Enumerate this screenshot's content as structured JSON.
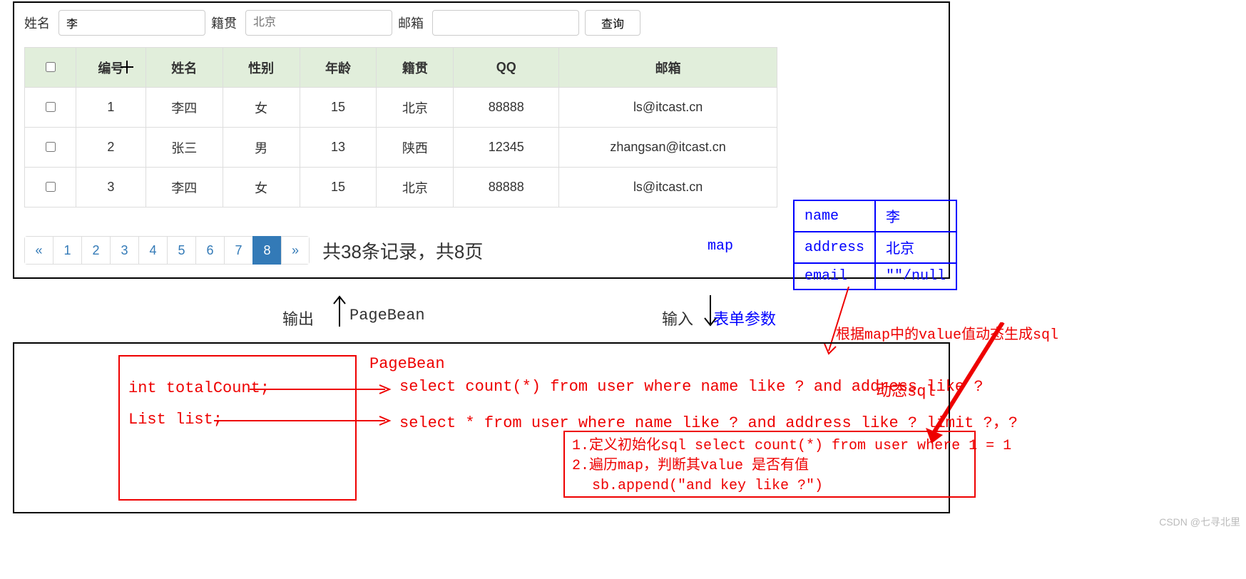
{
  "search": {
    "name_label": "姓名",
    "name_value": "李",
    "native_label": "籍贯",
    "native_placeholder": "北京",
    "email_label": "邮箱",
    "email_value": "",
    "query_btn": "查询"
  },
  "table": {
    "headers": [
      "",
      "编号",
      "姓名",
      "性别",
      "年龄",
      "籍贯",
      "QQ",
      "邮箱"
    ],
    "rows": [
      {
        "id": "1",
        "name": "李四",
        "sex": "女",
        "age": "15",
        "native": "北京",
        "qq": "88888",
        "email": "ls@itcast.cn"
      },
      {
        "id": "2",
        "name": "张三",
        "sex": "男",
        "age": "13",
        "native": "陕西",
        "qq": "12345",
        "email": "zhangsan@itcast.cn"
      },
      {
        "id": "3",
        "name": "李四",
        "sex": "女",
        "age": "15",
        "native": "北京",
        "qq": "88888",
        "email": "ls@itcast.cn"
      }
    ]
  },
  "pager": {
    "prev": "«",
    "pages": [
      "1",
      "2",
      "3",
      "4",
      "5",
      "6",
      "7",
      "8"
    ],
    "active_index": 7,
    "next": "»",
    "info": "共38条记录，共8页"
  },
  "map": {
    "label": "map",
    "rows": [
      {
        "k": "name",
        "v": "李"
      },
      {
        "k": "address",
        "v": "北京"
      },
      {
        "k": "email",
        "v": "\"\"/null"
      }
    ]
  },
  "io": {
    "out_label": "输出",
    "pagebean_label": "PageBean",
    "in_label": "输入",
    "form_param_label": "表单参数"
  },
  "gensql_label": "根据map中的value值动态生成sql",
  "pagebean_box": {
    "title": "PageBean",
    "line1": "int totalCount;",
    "line2": "List list;",
    "sql1": "select count(*) from user where name like ? and address like ?",
    "sql2": "select * from user where name like ? and address like ? limit ?，?",
    "dynsql": "动态sql"
  },
  "steps": {
    "l1": "1.定义初始化sql select count(*) from user where 1 = 1",
    "l2": "2.遍历map，判断其value 是否有值",
    "l3": "  sb.append(\"and  key like ?\")"
  },
  "watermark": "CSDN @七寻北里"
}
